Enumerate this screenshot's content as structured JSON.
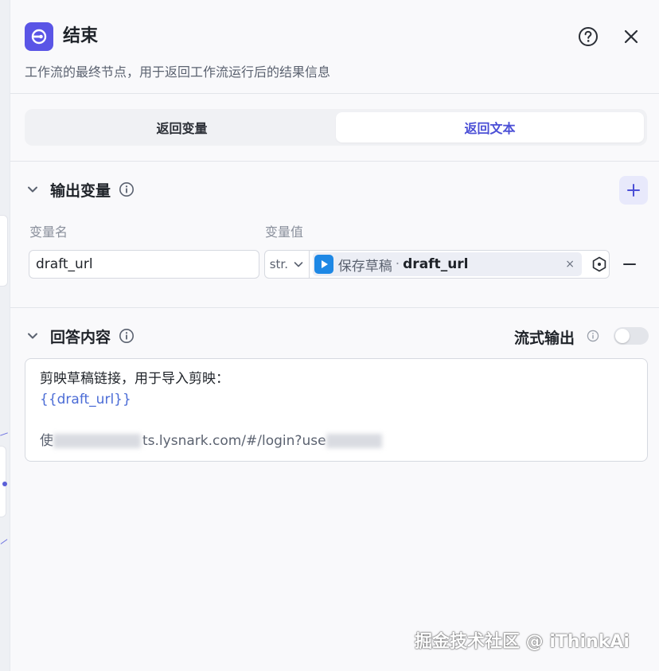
{
  "header": {
    "title": "结束",
    "description": "工作流的最终节点，用于返回工作流运行后的结果信息",
    "node_icon": "end-node-icon",
    "help_icon": "question-circle-icon",
    "close_icon": "close-icon"
  },
  "tabs": [
    {
      "label": "返回变量",
      "active": false
    },
    {
      "label": "返回文本",
      "active": true
    }
  ],
  "output_section": {
    "title": "输出变量",
    "col_name_label": "变量名",
    "col_value_label": "变量值",
    "rows": [
      {
        "name": "draft_url",
        "type": "str.",
        "ref_node": "保存草稿",
        "ref_separator": "·",
        "ref_var": "draft_url",
        "clear_label": "×"
      }
    ]
  },
  "answer_section": {
    "title": "回答内容",
    "stream_label": "流式输出",
    "stream_enabled": false,
    "line1": "剪映草稿链接，用于导入剪映：",
    "line2": "{{draft_url}}",
    "line4_prefix": "使",
    "line4_mid": "ts.lysnark.com/#/login?use"
  },
  "watermark": "掘金技术社区 @ iThinkAi",
  "colors": {
    "accent": "#4b4fd6",
    "node_icon_bg": "#5a55e6",
    "ref_icon_bg": "#1e88e5"
  }
}
